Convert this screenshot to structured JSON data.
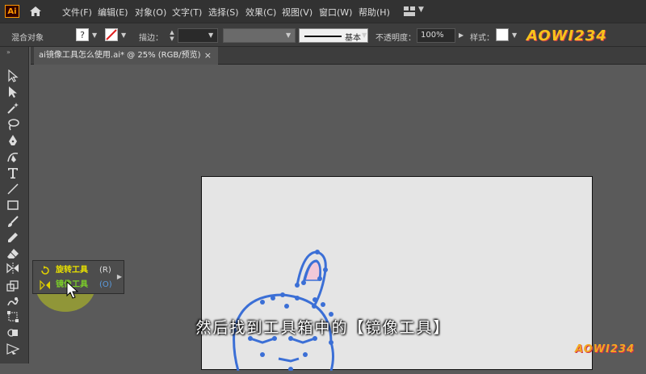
{
  "app": {
    "logo_text": "Ai"
  },
  "menu": {
    "items": [
      "文件(F)",
      "编辑(E)",
      "对象(O)",
      "文字(T)",
      "选择(S)",
      "效果(C)",
      "视图(V)",
      "窗口(W)",
      "帮助(H)"
    ]
  },
  "control_bar": {
    "selection_label": "混合对象",
    "fill_glyph": "?",
    "stroke_label": "描边：",
    "brush_label": "基本",
    "opacity_label": "不透明度：",
    "opacity_value": "100%",
    "style_label": "样式："
  },
  "document_tab": {
    "title": "ai镜像工具怎么使用.ai* @ 25% (RGB/预览)",
    "close_glyph": "×"
  },
  "tool_flyout": {
    "items": [
      {
        "label": "旋转工具",
        "shortcut": "(R)",
        "icon": "rotate-icon"
      },
      {
        "label": "镜像工具",
        "shortcut": "(O)",
        "icon": "reflect-icon"
      }
    ]
  },
  "subtitle": "然后找到工具箱中的【镜像工具】",
  "watermark": {
    "text": "AOWI234"
  },
  "colors": {
    "accent_orange": "#ff9a00",
    "halo": "#bec81e",
    "artwork_blue": "#3b6fd6"
  }
}
